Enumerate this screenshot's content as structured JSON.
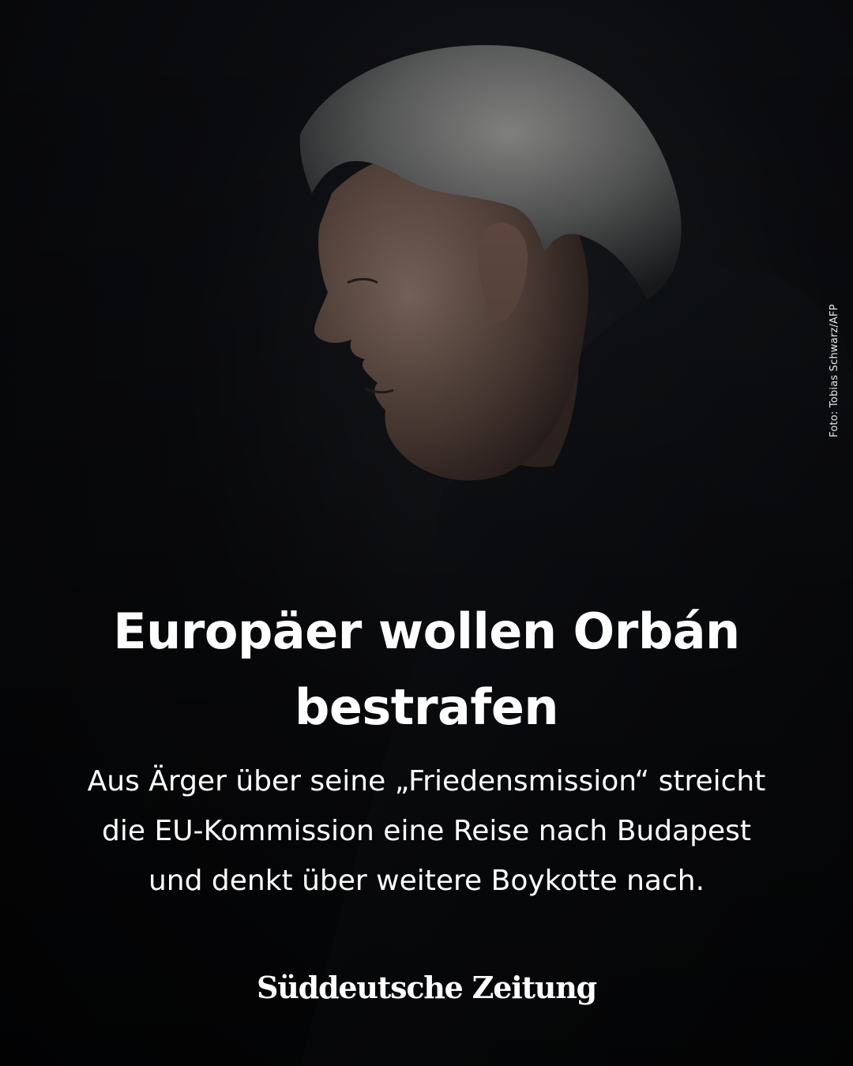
{
  "photo": {
    "credit": "Foto: Tobias Schwarz/AFP"
  },
  "article": {
    "headline_line1": "Europäer wollen Orbán",
    "headline_line2": "bestrafen",
    "subline_line1": "Aus Ärger über seine „Friedensmission“ streicht",
    "subline_line2": "die EU-Kommission eine Reise nach Budapest",
    "subline_line3": "und denkt über weitere Boykotte nach."
  },
  "brand": {
    "logo": "Süddeutsche Zeitung"
  }
}
